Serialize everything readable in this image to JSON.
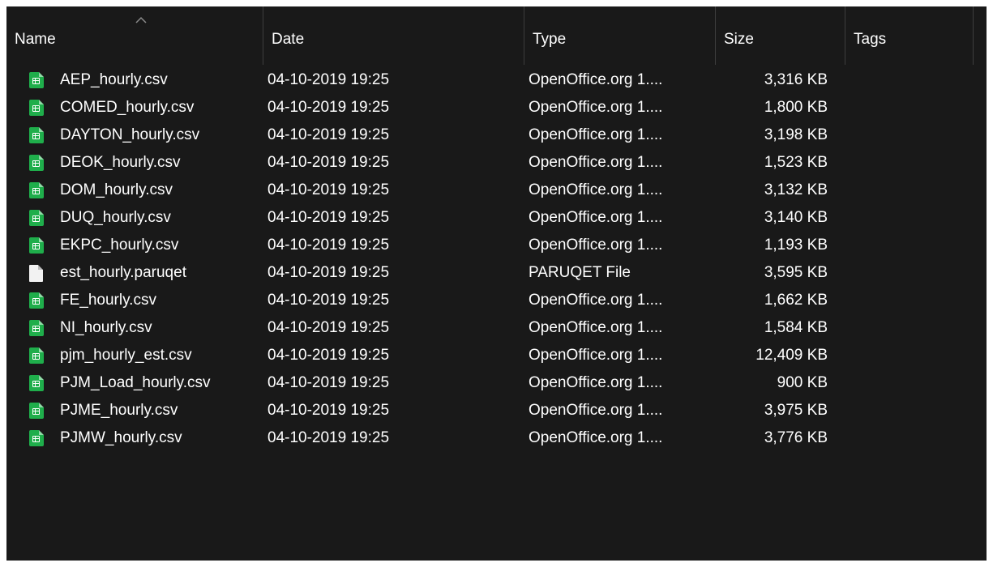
{
  "columns": {
    "name": "Name",
    "date": "Date",
    "type": "Type",
    "size": "Size",
    "tags": "Tags"
  },
  "sort": {
    "column": "name",
    "direction": "ascending",
    "icon": "chevron-up-icon"
  },
  "colors": {
    "background": "#191919",
    "text": "#ffffff",
    "divider": "#3d3d3d",
    "sheet_icon": "#1fae4b",
    "blank_icon": "#f2f2f2"
  },
  "files": [
    {
      "name": "AEP_hourly.csv",
      "date": "04-10-2019 19:25",
      "type": "OpenOffice.org 1....",
      "size": "3,316 KB",
      "icon": "spreadsheet-file-icon"
    },
    {
      "name": "COMED_hourly.csv",
      "date": "04-10-2019 19:25",
      "type": "OpenOffice.org 1....",
      "size": "1,800 KB",
      "icon": "spreadsheet-file-icon"
    },
    {
      "name": "DAYTON_hourly.csv",
      "date": "04-10-2019 19:25",
      "type": "OpenOffice.org 1....",
      "size": "3,198 KB",
      "icon": "spreadsheet-file-icon"
    },
    {
      "name": "DEOK_hourly.csv",
      "date": "04-10-2019 19:25",
      "type": "OpenOffice.org 1....",
      "size": "1,523 KB",
      "icon": "spreadsheet-file-icon"
    },
    {
      "name": "DOM_hourly.csv",
      "date": "04-10-2019 19:25",
      "type": "OpenOffice.org 1....",
      "size": "3,132 KB",
      "icon": "spreadsheet-file-icon"
    },
    {
      "name": "DUQ_hourly.csv",
      "date": "04-10-2019 19:25",
      "type": "OpenOffice.org 1....",
      "size": "3,140 KB",
      "icon": "spreadsheet-file-icon"
    },
    {
      "name": "EKPC_hourly.csv",
      "date": "04-10-2019 19:25",
      "type": "OpenOffice.org 1....",
      "size": "1,193 KB",
      "icon": "spreadsheet-file-icon"
    },
    {
      "name": "est_hourly.paruqet",
      "date": "04-10-2019 19:25",
      "type": "PARUQET File",
      "size": "3,595 KB",
      "icon": "blank-file-icon"
    },
    {
      "name": "FE_hourly.csv",
      "date": "04-10-2019 19:25",
      "type": "OpenOffice.org 1....",
      "size": "1,662 KB",
      "icon": "spreadsheet-file-icon"
    },
    {
      "name": "NI_hourly.csv",
      "date": "04-10-2019 19:25",
      "type": "OpenOffice.org 1....",
      "size": "1,584 KB",
      "icon": "spreadsheet-file-icon"
    },
    {
      "name": "pjm_hourly_est.csv",
      "date": "04-10-2019 19:25",
      "type": "OpenOffice.org 1....",
      "size": "12,409 KB",
      "icon": "spreadsheet-file-icon"
    },
    {
      "name": "PJM_Load_hourly.csv",
      "date": "04-10-2019 19:25",
      "type": "OpenOffice.org 1....",
      "size": "900 KB",
      "icon": "spreadsheet-file-icon"
    },
    {
      "name": "PJME_hourly.csv",
      "date": "04-10-2019 19:25",
      "type": "OpenOffice.org 1....",
      "size": "3,975 KB",
      "icon": "spreadsheet-file-icon"
    },
    {
      "name": "PJMW_hourly.csv",
      "date": "04-10-2019 19:25",
      "type": "OpenOffice.org 1....",
      "size": "3,776 KB",
      "icon": "spreadsheet-file-icon"
    }
  ]
}
